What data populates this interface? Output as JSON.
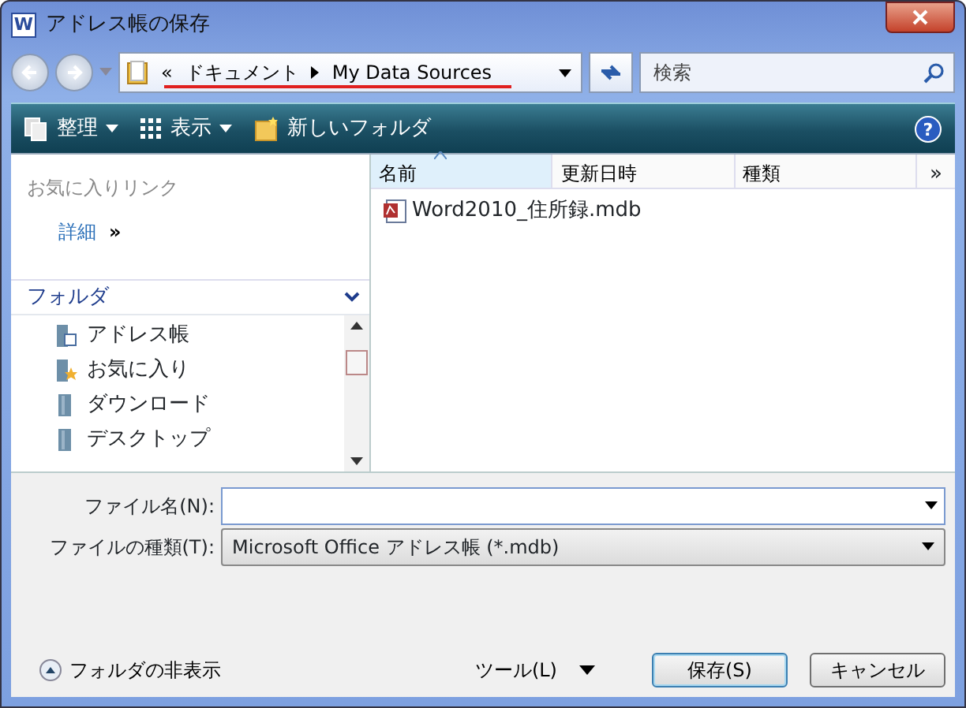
{
  "window": {
    "title": "アドレス帳の保存",
    "app_icon_letter": "W"
  },
  "help": "?",
  "address_bar": {
    "overflow": "«",
    "path": [
      {
        "label": "ドキュメント"
      },
      {
        "label": "My Data Sources"
      }
    ],
    "underlined": true
  },
  "search": {
    "placeholder": "検索"
  },
  "toolbar": {
    "items": [
      {
        "label": "整理",
        "kind": "organize"
      },
      {
        "label": "表示",
        "kind": "views"
      },
      {
        "label": "新しいフォルダ",
        "kind": "newfolder"
      }
    ]
  },
  "favorite_links": {
    "title": "お気に入りリンク",
    "more": "詳細",
    "more_chevron": "»"
  },
  "folders": {
    "title": "フォルダ",
    "expanded": true,
    "items": [
      {
        "label": "アドレス帳",
        "kind": "contacts"
      },
      {
        "label": "お気に入り",
        "kind": "favorites"
      },
      {
        "label": "ダウンロード",
        "kind": "folder"
      },
      {
        "label": "デスクトップ",
        "kind": "folder"
      }
    ]
  },
  "file_list": {
    "columns": [
      {
        "label": "名前",
        "sorted": true
      },
      {
        "label": "更新日時",
        "sorted": false
      },
      {
        "label": "種類",
        "sorted": false
      }
    ],
    "more": "»",
    "files": [
      {
        "name": "Word2010_住所録.mdb"
      }
    ]
  },
  "form": {
    "file_name": {
      "label": "ファイル名(N):"
    },
    "file_type": {
      "label": "ファイルの種類(T):",
      "value": "Microsoft Office アドレス帳 (*.mdb)"
    }
  },
  "hide_folders": "フォルダの非表示",
  "tools": "ツール(L)",
  "buttons": [
    {
      "label": "保存(S)",
      "default": true
    },
    {
      "label": "キャンセル",
      "default": false
    }
  ]
}
